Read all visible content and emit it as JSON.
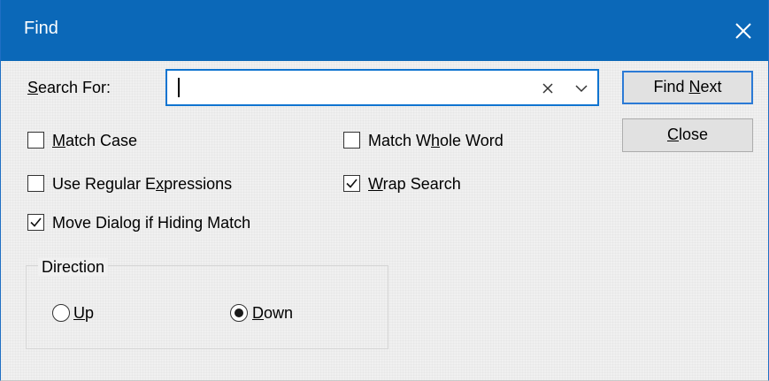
{
  "dialog": {
    "title": "Find",
    "close_icon": "close-icon"
  },
  "search": {
    "label_mnemonic": "S",
    "label_rest": "earch For:",
    "value": "",
    "clear_icon": "clear-icon",
    "dropdown_icon": "chevron-down-icon"
  },
  "buttons": {
    "find_next_pre": "Find ",
    "find_next_mnemonic": "N",
    "find_next_post": "ext",
    "close_mnemonic": "C",
    "close_post": "lose"
  },
  "options": {
    "match_case": {
      "mnemonic": "M",
      "rest": "atch Case",
      "checked": false
    },
    "match_whole_word": {
      "pre": "Match W",
      "mnemonic": "h",
      "post": "ole Word",
      "checked": false
    },
    "use_regex": {
      "pre": "Use Regular E",
      "mnemonic": "x",
      "post": "pressions",
      "checked": false
    },
    "wrap_search": {
      "mnemonic": "W",
      "rest": "rap Search",
      "checked": true
    },
    "move_dialog": {
      "text": "Move Dialog if Hiding Match",
      "checked": true
    }
  },
  "direction": {
    "label": "Direction",
    "up": {
      "mnemonic": "U",
      "rest": "p",
      "selected": false
    },
    "down": {
      "mnemonic": "D",
      "rest": "own",
      "selected": true
    }
  }
}
